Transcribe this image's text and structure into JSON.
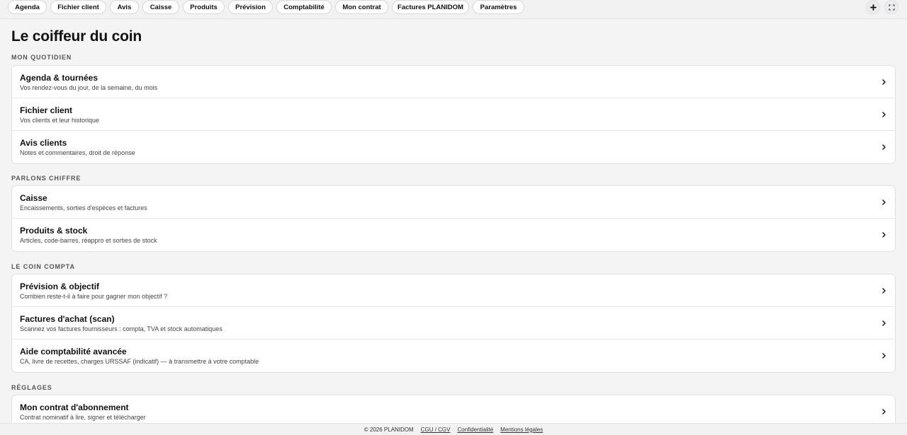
{
  "nav": {
    "tabs": [
      {
        "label": "Agenda"
      },
      {
        "label": "Fichier client"
      },
      {
        "label": "Avis"
      },
      {
        "label": "Caisse"
      },
      {
        "label": "Produits"
      },
      {
        "label": "Prévision"
      },
      {
        "label": "Comptabilité"
      },
      {
        "label": "Mon contrat"
      },
      {
        "label": "Factures PLANIDOM"
      },
      {
        "label": "Paramètres"
      }
    ],
    "actions": {
      "add_icon": "plus-icon",
      "fullscreen_icon": "expand-icon"
    }
  },
  "page": {
    "title": "Le coiffeur du coin"
  },
  "sections": [
    {
      "label": "MON QUOTIDIEN",
      "items": [
        {
          "title": "Agenda & tournées",
          "subtitle": "Vos rendez-vous du jour, de la semaine, du mois"
        },
        {
          "title": "Fichier client",
          "subtitle": "Vos clients et leur historique"
        },
        {
          "title": "Avis clients",
          "subtitle": "Notes et commentaires, droit de réponse"
        }
      ]
    },
    {
      "label": "PARLONS CHIFFRE",
      "items": [
        {
          "title": "Caisse",
          "subtitle": "Encaissements, sorties d'espèces et factures"
        },
        {
          "title": "Produits & stock",
          "subtitle": "Articles, code-barres, réappro et sorties de stock"
        }
      ]
    },
    {
      "label": "LE COIN COMPTA",
      "items": [
        {
          "title": "Prévision & objectif",
          "subtitle": "Combien reste-t-il à faire pour gagner mon objectif ?"
        },
        {
          "title": "Factures d'achat (scan)",
          "subtitle": "Scannez vos factures fournisseurs : compta, TVA et stock automatiques"
        },
        {
          "title": "Aide comptabilité avancée",
          "subtitle": "CA, livre de recettes, charges URSSAF (indicatif) — à transmettre à votre comptable"
        }
      ]
    },
    {
      "label": "RÉGLAGES",
      "items": [
        {
          "title": "Mon contrat d'abonnement",
          "subtitle": "Contrat nominatif à lire, signer et télécharger"
        }
      ]
    }
  ],
  "footer": {
    "copyright": "© 2026 PLANIDOM",
    "links": [
      "CGU / CGV",
      "Confidentialité",
      "Mentions légales"
    ]
  }
}
